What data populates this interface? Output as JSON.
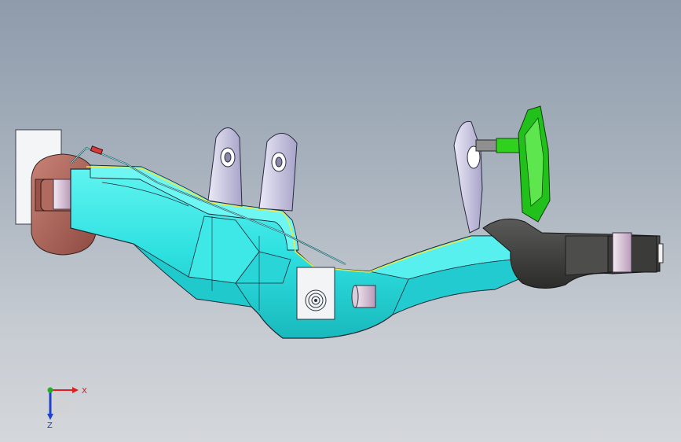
{
  "viewport": {
    "background_top": "#8e9bab",
    "background_bottom": "#d4d7db"
  },
  "model": {
    "main_color": "#2ee0e0",
    "brown_part_color": "#b46a5e",
    "dark_part_color": "#3f3f3f",
    "green_part_color": "#22c01a",
    "bracket_color": "#c9c6e4",
    "edge_color": "#1e2a36",
    "weld_seam_color": "#e8e84a"
  },
  "triad": {
    "x_label": "X",
    "z_label": "Z",
    "x_color": "#e02020",
    "y_color": "#20b020",
    "z_color": "#2040d0"
  }
}
